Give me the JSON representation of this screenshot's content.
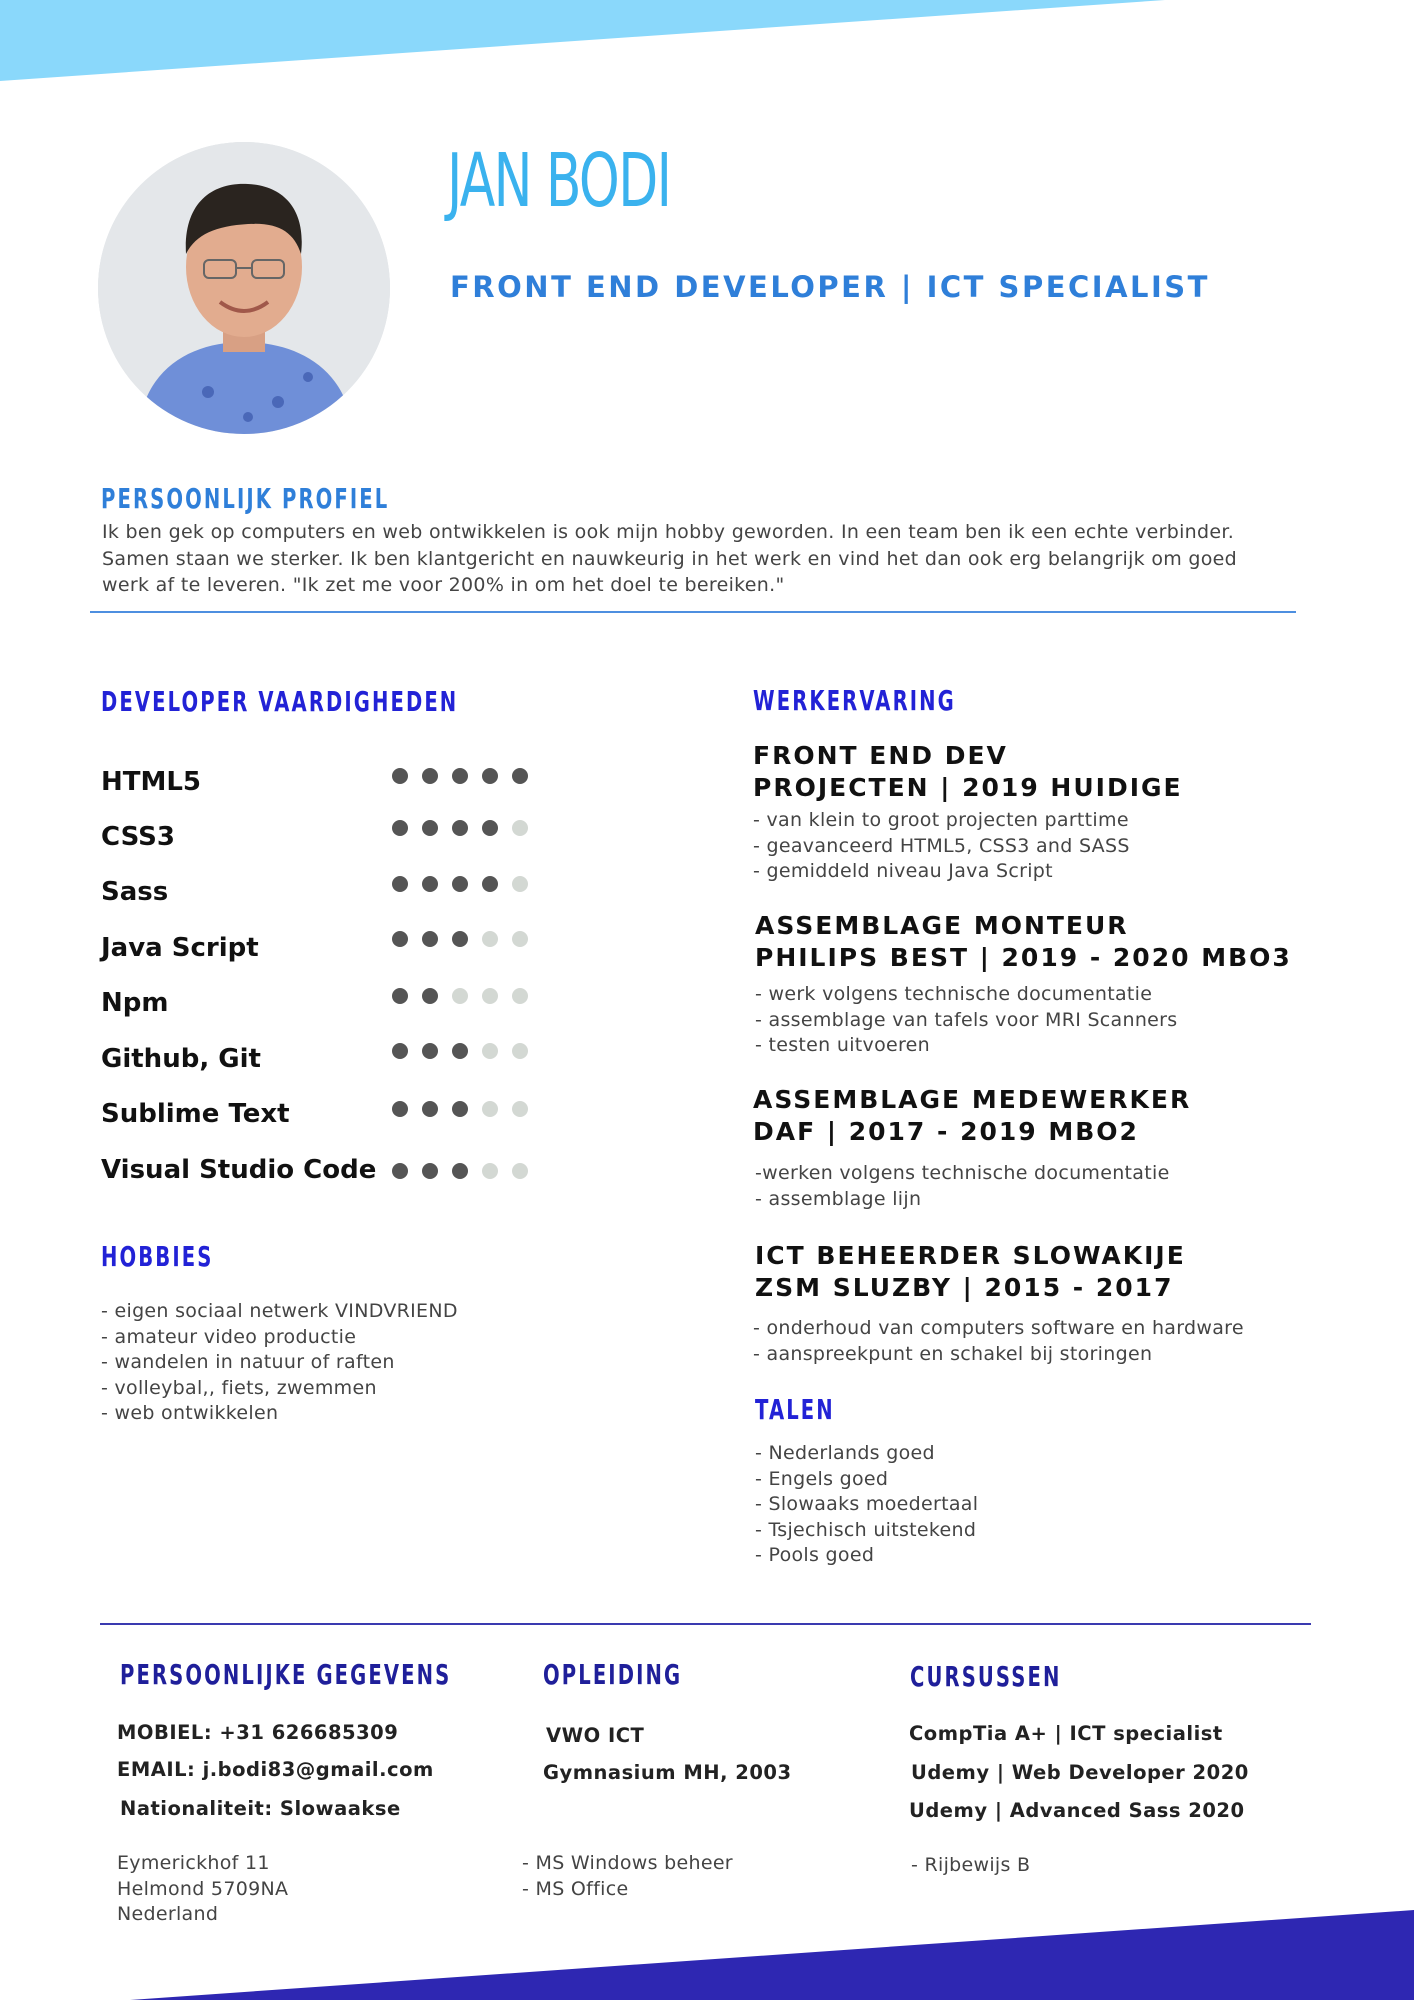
{
  "colors": {
    "top_band": "#8ad8fb",
    "bottom_band": "#2e27b2",
    "name": "#3ab2ee",
    "subtitle": "#2f7fd9",
    "heading_blue": "#2222d6",
    "heading_navy": "#1f1f9a",
    "dot_filled": "#555555",
    "dot_empty": "#d3d8d3"
  },
  "header": {
    "name": "JAN BODI",
    "subtitle": "FRONT END DEVELOPER | ICT SPECIALIST"
  },
  "profile": {
    "heading": "PERSOONLIJK PROFIEL",
    "lines": [
      "Ik ben gek op computers en web ontwikkelen is ook mijn hobby geworden. In een team ben ik een echte verbinder.",
      "Samen staan we sterker.  Ik ben klantgericht en nauwkeurig in het werk en vind het dan ook erg belangrijk om goed",
      "werk af te leveren. \"Ik zet me voor 200% in om het doel te bereiken.\""
    ]
  },
  "skills": {
    "heading": "DEVELOPER VAARDIGHEDEN",
    "items": [
      {
        "label": "HTML5",
        "level": 5,
        "max": 5
      },
      {
        "label": "CSS3",
        "level": 4,
        "max": 5
      },
      {
        "label": "Sass",
        "level": 4,
        "max": 5
      },
      {
        "label": "Java Script",
        "level": 3,
        "max": 5
      },
      {
        "label": "Npm",
        "level": 2,
        "max": 5
      },
      {
        "label": "Github, Git",
        "level": 3,
        "max": 5
      },
      {
        "label": "Sublime Text",
        "level": 3,
        "max": 5
      },
      {
        "label": "Visual Studio Code",
        "level": 3,
        "max": 5
      }
    ]
  },
  "hobbies": {
    "heading": "HOBBIES",
    "items": [
      "- eigen sociaal netwerk VINDVRIEND",
      "- amateur video productie",
      "- wandelen in natuur of raften",
      "- volleybal,, fiets, zwemmen",
      "- web ontwikkelen"
    ]
  },
  "work": {
    "heading": "WERKERVARING",
    "jobs": [
      {
        "title1": "FRONT END DEV",
        "title2": "PROJECTEN | 2019 HUIDIGE",
        "items": [
          "- van klein to groot projecten parttime",
          "- geavanceerd HTML5, CSS3 and SASS",
          "- gemiddeld niveau Java Script"
        ]
      },
      {
        "title1": "ASSEMBLAGE MONTEUR",
        "title2": "PHILIPS BEST | 2019 - 2020 MBO3",
        "items": [
          "- werk volgens technische documentatie",
          "- assemblage van tafels voor MRI Scanners",
          "- testen uitvoeren"
        ]
      },
      {
        "title1": "ASSEMBLAGE MEDEWERKER",
        "title2": "DAF | 2017 - 2019 MBO2",
        "items": [
          "-werken volgens technische documentatie",
          "- assemblage lijn"
        ]
      },
      {
        "title1": "ICT BEHEERDER SLOWAKIJE",
        "title2": "ZSM SLUZBY | 2015 - 2017",
        "items": [
          "- onderhoud van computers software en hardware",
          "- aanspreekpunt en schakel bij storingen"
        ]
      }
    ]
  },
  "languages": {
    "heading": "TALEN",
    "items": [
      "- Nederlands goed",
      "- Engels goed",
      "- Slowaaks moedertaal",
      "- Tsjechisch uitstekend",
      "- Pools goed"
    ]
  },
  "personal": {
    "heading": "PERSOONLIJKE GEGEVENS",
    "mobile": "MOBIEL: +31 626685309",
    "email": "EMAIL:  j.bodi83@gmail.com",
    "nationality": "Nationaliteit:  Slowaakse",
    "address": [
      "Eymerickhof 11",
      "Helmond 5709NA",
      "Nederland"
    ]
  },
  "education": {
    "heading": "OPLEIDING",
    "degree": "VWO ICT",
    "school": "Gymnasium MH, 2003",
    "items": [
      "-  MS Windows beheer",
      "-  MS Office"
    ]
  },
  "courses": {
    "heading": "CURSUSSEN",
    "items": [
      "CompTia A+ | ICT specialist",
      "Udemy | Web Developer 2020",
      "Udemy | Advanced Sass 2020"
    ],
    "extra": "-  Rijbewijs B"
  }
}
